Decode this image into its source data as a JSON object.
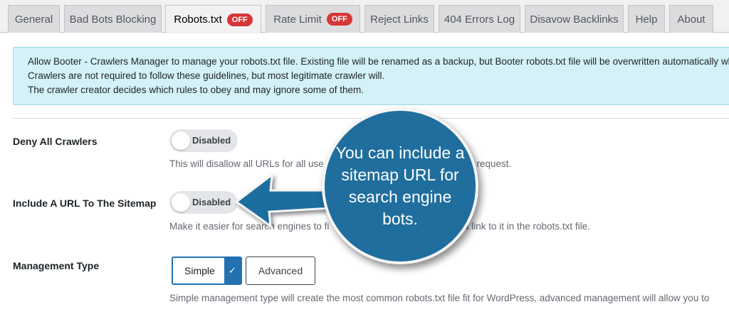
{
  "tabs": [
    {
      "label": "General",
      "badge": ""
    },
    {
      "label": "Bad Bots Blocking",
      "badge": ""
    },
    {
      "label": "Robots.txt",
      "badge": "OFF"
    },
    {
      "label": "Rate Limit",
      "badge": "OFF"
    },
    {
      "label": "Reject Links",
      "badge": ""
    },
    {
      "label": "404 Errors Log",
      "badge": ""
    },
    {
      "label": "Disavow Backlinks",
      "badge": ""
    },
    {
      "label": "Help",
      "badge": ""
    },
    {
      "label": "About",
      "badge": ""
    }
  ],
  "active_tab": "Robots.txt",
  "notice": {
    "line1": "Allow Booter - Crawlers Manager to manage your robots.txt file. Existing file will be renamed as a backup, but Booter robots.txt file will be overwritten automatically when sa",
    "line2": "Crawlers are not required to follow these guidelines, but most legitimate crawler will.",
    "line3": "The crawler creator decides which rules to obey and may ignore some of them."
  },
  "settings": {
    "deny_all": {
      "label": "Deny All Crawlers",
      "toggle": "Disabled",
      "help_left": "This will disallow all URLs for all use",
      "help_right": "x request."
    },
    "sitemap": {
      "label": "Include A URL To The Sitemap",
      "toggle": "Disabled",
      "help_left": "Make it easier for search engines to fi",
      "help_right": "a link to it in the robots.txt file."
    },
    "management": {
      "label": "Management Type",
      "simple": "Simple",
      "advanced": "Advanced",
      "check": "✓",
      "help": "Simple management type will create the most common robots.txt file fit for WordPress, advanced management will allow you to"
    }
  },
  "callout": {
    "text": "You can include a sitemap URL for search engine bots."
  },
  "colors": {
    "accent": "#2271b1",
    "badge": "#d63638",
    "notice_bg": "#d4f1f7",
    "callout": "#1f6e9e"
  }
}
